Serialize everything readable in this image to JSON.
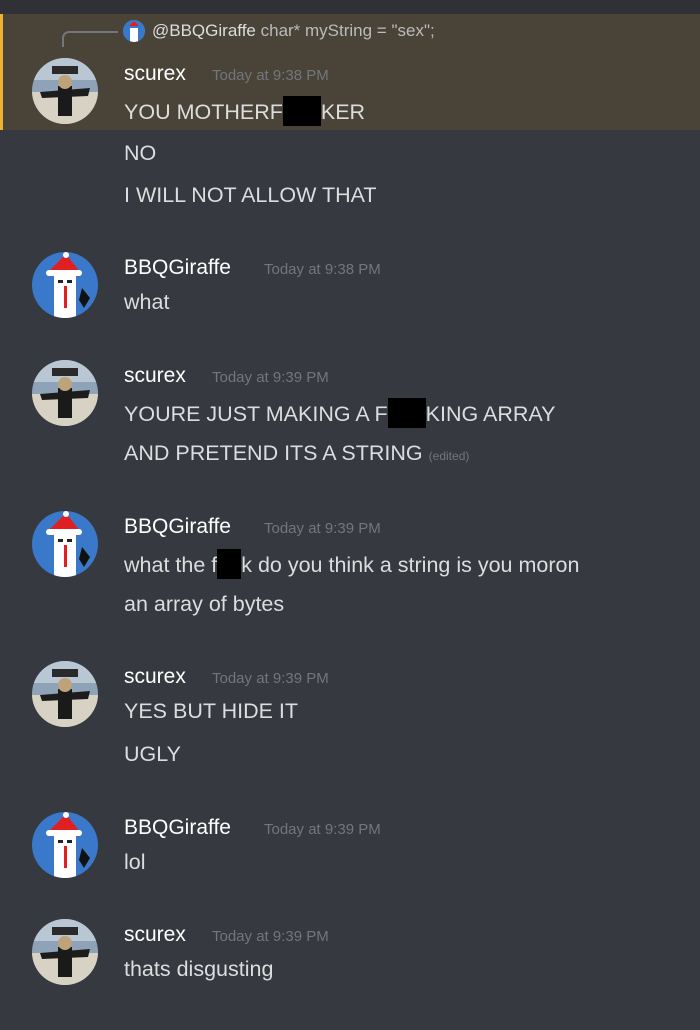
{
  "reply": {
    "username": "@BBQGiraffe",
    "text": "char* myString = \"sex\";"
  },
  "messages": [
    {
      "username": "scurex",
      "timestamp": "Today at 9:38 PM",
      "lines": [
        {
          "pre": "YOU MOTHERF",
          "post": "KER"
        },
        {
          "text": "NO"
        },
        {
          "text": "I WILL NOT ALLOW THAT"
        }
      ]
    },
    {
      "username": "BBQGiraffe",
      "timestamp": "Today at 9:38 PM",
      "lines": [
        {
          "text": "what"
        }
      ]
    },
    {
      "username": "scurex",
      "timestamp": "Today at 9:39 PM",
      "lines": [
        {
          "pre": "YOURE JUST MAKING A F",
          "post": "KING ARRAY"
        },
        {
          "text": "AND PRETEND ITS A STRING",
          "edited": "(edited)"
        }
      ]
    },
    {
      "username": "BBQGiraffe",
      "timestamp": "Today at 9:39 PM",
      "lines": [
        {
          "pre": "what the f",
          "post": "k do you think a string is you moron"
        },
        {
          "text": "an array of bytes"
        }
      ]
    },
    {
      "username": "scurex",
      "timestamp": "Today at 9:39 PM",
      "lines": [
        {
          "text": "YES BUT HIDE IT"
        },
        {
          "text": "UGLY"
        }
      ]
    },
    {
      "username": "BBQGiraffe",
      "timestamp": "Today at 9:39 PM",
      "lines": [
        {
          "text": "lol"
        }
      ]
    },
    {
      "username": "scurex",
      "timestamp": "Today at 9:39 PM",
      "lines": [
        {
          "text": "thats disgusting"
        }
      ]
    }
  ],
  "colors": {
    "background": "#36393f",
    "mention_highlight": "#4a4438",
    "mention_bar": "#f0b232",
    "username": "#ffffff",
    "message_text": "#dcddde",
    "timestamp": "#72767d"
  }
}
